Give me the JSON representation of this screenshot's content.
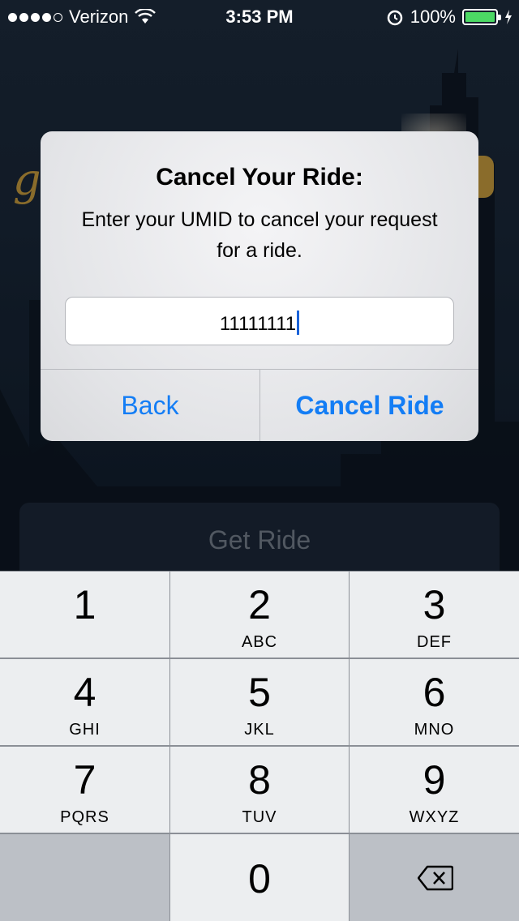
{
  "status_bar": {
    "carrier": "Verizon",
    "time": "3:53 PM",
    "battery": "100%",
    "signal_bars_filled": 4,
    "signal_bars_total": 5
  },
  "alert": {
    "title": "Cancel Your Ride:",
    "message": "Enter your UMID to cancel your request for a ride.",
    "input_value": "11111111",
    "back_label": "Back",
    "cancel_label": "Cancel Ride"
  },
  "background": {
    "get_ride_label": "Get Ride"
  },
  "keypad": {
    "keys": [
      {
        "num": "1",
        "letters": ""
      },
      {
        "num": "2",
        "letters": "ABC"
      },
      {
        "num": "3",
        "letters": "DEF"
      },
      {
        "num": "4",
        "letters": "GHI"
      },
      {
        "num": "5",
        "letters": "JKL"
      },
      {
        "num": "6",
        "letters": "MNO"
      },
      {
        "num": "7",
        "letters": "PQRS"
      },
      {
        "num": "8",
        "letters": "TUV"
      },
      {
        "num": "9",
        "letters": "WXYZ"
      },
      {
        "num": "0",
        "letters": ""
      }
    ],
    "backspace_icon": "backspace-icon"
  },
  "colors": {
    "accent": "#137df5",
    "battery": "#4cd964",
    "background": "#172434"
  }
}
